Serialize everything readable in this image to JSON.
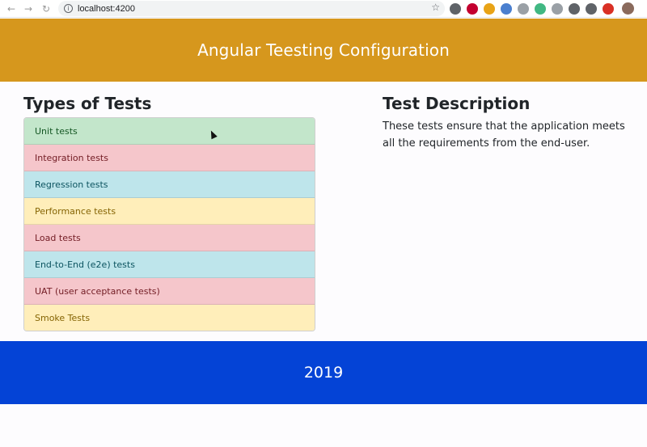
{
  "browser": {
    "url": "localhost:4200",
    "back_icon": "←",
    "forward_icon": "→",
    "reload_icon": "↻",
    "info_icon": "i",
    "star_icon": "☆",
    "menu_icon": "⋮"
  },
  "header": {
    "title": "Angular Teesting Configuration",
    "background": "#d6971d"
  },
  "types": {
    "heading": "Types of Tests",
    "items": [
      {
        "label": "Unit tests",
        "variant": "success"
      },
      {
        "label": "Integration tests",
        "variant": "danger"
      },
      {
        "label": "Regression tests",
        "variant": "info"
      },
      {
        "label": "Performance tests",
        "variant": "warning"
      },
      {
        "label": "Load tests",
        "variant": "danger"
      },
      {
        "label": "End-to-End (e2e) tests",
        "variant": "info"
      },
      {
        "label": "UAT (user acceptance tests)",
        "variant": "danger"
      },
      {
        "label": "Smoke Tests",
        "variant": "warning"
      }
    ]
  },
  "description": {
    "heading": "Test Description",
    "text": "These tests ensure that the application meets all the requirements from the end-user."
  },
  "footer": {
    "text": "2019",
    "background": "#0443d6"
  }
}
